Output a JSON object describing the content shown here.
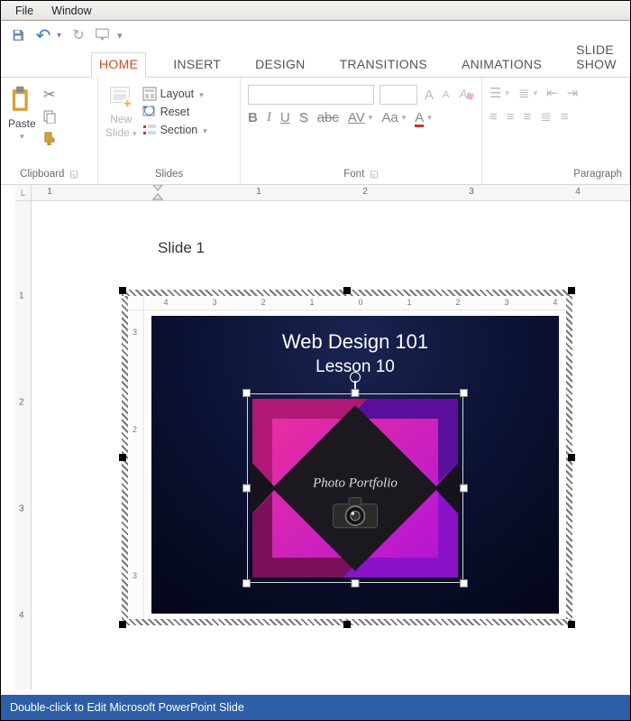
{
  "menubar": {
    "file": "File",
    "window": "Window"
  },
  "tabs": {
    "home": "HOME",
    "insert": "INSERT",
    "design": "DESIGN",
    "transitions": "TRANSITIONS",
    "animations": "ANIMATIONS",
    "slideshow": "SLIDE SHOW"
  },
  "ribbon": {
    "clipboard": {
      "label": "Clipboard",
      "paste": "Paste"
    },
    "slides": {
      "label": "Slides",
      "new_slide_line1": "New",
      "new_slide_line2": "Slide",
      "layout": "Layout",
      "reset": "Reset",
      "section": "Section"
    },
    "font": {
      "label": "Font",
      "increase": "A",
      "decrease": "A",
      "bold": "B",
      "italic": "I",
      "underline": "U",
      "shadow": "S",
      "strike": "abc",
      "spacing": "AV",
      "case": "Aa",
      "color": "A"
    },
    "paragraph": {
      "label": "Paragraph"
    }
  },
  "outer_ruler": {
    "marks": [
      "1",
      "1",
      "2",
      "3",
      "4"
    ]
  },
  "vruler": {
    "marks": [
      "1",
      "2",
      "3",
      "4"
    ]
  },
  "document": {
    "slide_label": "Slide 1"
  },
  "embedded_ruler_h": {
    "marks": [
      "4",
      "3",
      "2",
      "1",
      "0",
      "1",
      "2",
      "3",
      "4"
    ]
  },
  "embedded_ruler_v": {
    "marks": [
      "3",
      "2",
      "3"
    ]
  },
  "slide": {
    "title": "Web Design 101",
    "subtitle": "Lesson 10",
    "artwork_caption": "Photo Portfolio"
  },
  "statusbar": {
    "hint": "Double-click to Edit Microsoft PowerPoint Slide"
  }
}
